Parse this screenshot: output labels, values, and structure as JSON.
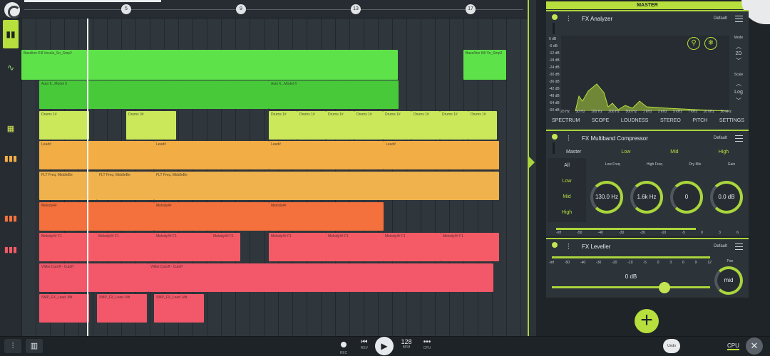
{
  "transport": {
    "tempo": "128",
    "tempo_label": "BPM",
    "rec_label": "REC",
    "rev_label": "REV",
    "cpu_sub": "CPU"
  },
  "bottom": {
    "undo": "Undo",
    "cpu": "CPU"
  },
  "ruler": {
    "markers": [
      "5",
      "9",
      "13",
      "17"
    ]
  },
  "clips": [
    {
      "label": "Bassline Kill Vocals_Sn_Smp2",
      "color": "#5ee24a"
    },
    {
      "label": "Bass/line Kill Vo_Smp2",
      "color": "#5ee24a"
    },
    {
      "label": "Auto fi...Model fi",
      "color": "#48c93a"
    },
    {
      "label": "Auto fi...Model fi",
      "color": "#48c93a"
    },
    {
      "label": "Drums 1#",
      "color": "#cbe85b"
    },
    {
      "label": "Drums 3#",
      "color": "#cbe85b"
    },
    {
      "label": "Drums 1#",
      "color": "#cbe85b"
    },
    {
      "label": "Drums 1#",
      "color": "#cbe85b"
    },
    {
      "label": "Drums 1#",
      "color": "#cbe85b"
    },
    {
      "label": "Drums 1#",
      "color": "#cbe85b"
    },
    {
      "label": "Drums 1#",
      "color": "#cbe85b"
    },
    {
      "label": "Drums 1#",
      "color": "#cbe85b"
    },
    {
      "label": "Drums 1#",
      "color": "#cbe85b"
    },
    {
      "label": "Drums 1#",
      "color": "#cbe85b"
    },
    {
      "label": "Lead#",
      "color": "#f2ad45"
    },
    {
      "label": "Lead#",
      "color": "#f2ad45"
    },
    {
      "label": "Lead#",
      "color": "#f2ad45"
    },
    {
      "label": "Lead#",
      "color": "#f2ad45"
    },
    {
      "label": "FLT Freq. MiddleBe",
      "color": "#efb24c"
    },
    {
      "label": "FLT Freq. MiddleBe",
      "color": "#efb24c"
    },
    {
      "label": "FLT Freq. MiddleBe",
      "color": "#efb24c"
    },
    {
      "label": "Melody4#",
      "color": "#f4713d"
    },
    {
      "label": "Melody4#",
      "color": "#f4713d"
    },
    {
      "label": "Melody4#",
      "color": "#f4713d"
    },
    {
      "label": "Melody4# F1",
      "color": "#f55b66"
    },
    {
      "label": "Melody4# F1",
      "color": "#f55b66"
    },
    {
      "label": "Melody4# F1",
      "color": "#f55b66"
    },
    {
      "label": "Melody4# F1",
      "color": "#f55b66"
    },
    {
      "label": "Melody4# F1",
      "color": "#f55b66"
    },
    {
      "label": "Melody4# F1",
      "color": "#f55b66"
    },
    {
      "label": "Melody4# F1",
      "color": "#f55b66"
    },
    {
      "label": "Melody4# F1",
      "color": "#f55b66"
    },
    {
      "label": "Vfilter.Cutoff - Cutoff",
      "color": "#f2586a"
    },
    {
      "label": "Vfilter.Cutoff - Cutoff",
      "color": "#f2586a"
    },
    {
      "label": "SMP_FX_Lead..Mit",
      "color": "#f2586a"
    },
    {
      "label": "SMP_FX_Lead..Mit",
      "color": "#f2586a"
    },
    {
      "label": "SMP_FX_Lead..Mit",
      "color": "#f2586a"
    }
  ],
  "master": {
    "title": "MASTER"
  },
  "analyzer": {
    "title": "FX Analyzer",
    "preset": "Default",
    "db_labels": [
      "0 dB",
      "-6 dB",
      "-12 dB",
      "-18 dB",
      "-24 dB",
      "-30 dB",
      "-36 dB",
      "-42 dB",
      "-48 dB",
      "-54 dB",
      "-60 dB"
    ],
    "freq_labels": [
      "20 Hz",
      "50 Hz",
      "100 Hz",
      "200 Hz",
      "500 Hz",
      "1 kHz",
      "2 kHz",
      "5 kHz",
      "7 kHz",
      "10 kHz",
      "20 kHz"
    ],
    "side_mode": "Mode",
    "side_mode_val": "2D",
    "side_scale": "Scale",
    "side_scale_val": "Log",
    "tabs": [
      "SPECTRUM",
      "SCOPE",
      "LOUDNESS",
      "STEREO",
      "PITCH",
      "SETTINGS"
    ]
  },
  "compressor": {
    "title": "FX Multiband Compressor",
    "preset": "Default",
    "bands": [
      "Master",
      "Low",
      "Mid",
      "High"
    ],
    "band_list": [
      "All",
      "Low",
      "Mid",
      "High"
    ],
    "knob_labels": [
      "Low Freq",
      "High Freq",
      "Dry Mix",
      "Gain"
    ],
    "knob_values": [
      "130.0 Hz",
      "1.6k Hz",
      "0",
      "0.0 dB"
    ],
    "scale": [
      "-inf",
      "-50",
      "-40",
      "-30",
      "-20",
      "-10",
      "-5",
      "0",
      "3",
      "6"
    ]
  },
  "leveller": {
    "title": "FX Leveller",
    "preset": "Default",
    "scale": [
      "-inf",
      "-50",
      "-40",
      "-30",
      "-20",
      "-10",
      "-5",
      "0",
      "3",
      "6",
      "9",
      "12"
    ],
    "volume": "0 dB",
    "pan_label": "Pan",
    "pan_value": "mid"
  }
}
